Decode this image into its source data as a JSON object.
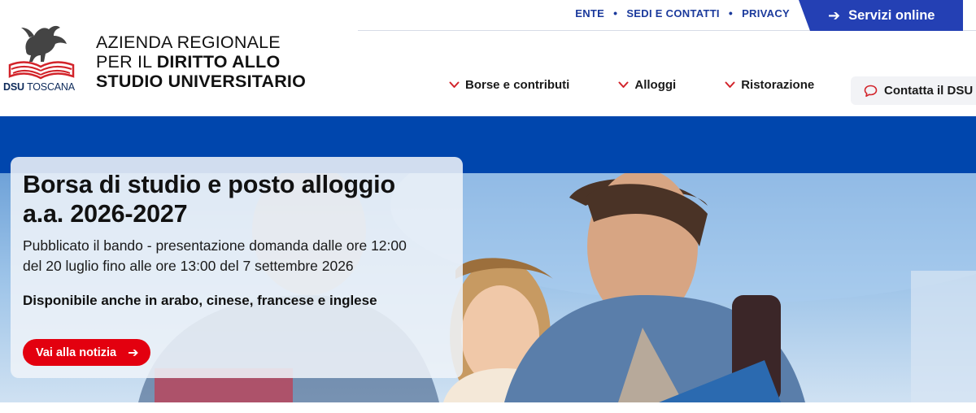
{
  "logo": {
    "name_bold": "DSU",
    "name_rest": "TOSCANA"
  },
  "agency": {
    "line1": "AZIENDA REGIONALE",
    "line2_prefix": "PER IL ",
    "line2_bold": "DIRITTO ALLO",
    "line3": "STUDIO UNIVERSITARIO"
  },
  "utility_nav": {
    "links": [
      "ENTE",
      "SEDI E CONTATTI",
      "PRIVACY"
    ],
    "separator": "•"
  },
  "servizi": {
    "label": "Servizi online",
    "icon": "arrow-right-icon"
  },
  "main_nav": {
    "items": [
      {
        "label": "Borse e contributi",
        "icon": "chevron-down-icon"
      },
      {
        "label": "Alloggi",
        "icon": "chevron-down-icon"
      },
      {
        "label": "Ristorazione",
        "icon": "chevron-down-icon"
      }
    ]
  },
  "contact": {
    "label": "Contatta il DSU",
    "icon": "chat-bubble-icon"
  },
  "hero": {
    "title_line1": "Borsa di studio e posto alloggio",
    "title_line2": "a.a. 2026-2027",
    "desc_line1": "Pubblicato il bando - presentazione domanda dalle ore 12:00",
    "desc_line2": "del 20 luglio fino alle ore 13:00 del 7 settembre 2026",
    "available": "Disponibile anche in arabo, cinese, francese e inglese",
    "cta_label": "Vai alla notizia",
    "cta_icon": "arrow-right-icon"
  },
  "colors": {
    "brand_blue": "#0046ad",
    "servizi_blue": "#2440b4",
    "accent_red": "#e3000f",
    "nav_link_blue": "#1b3a9c"
  }
}
